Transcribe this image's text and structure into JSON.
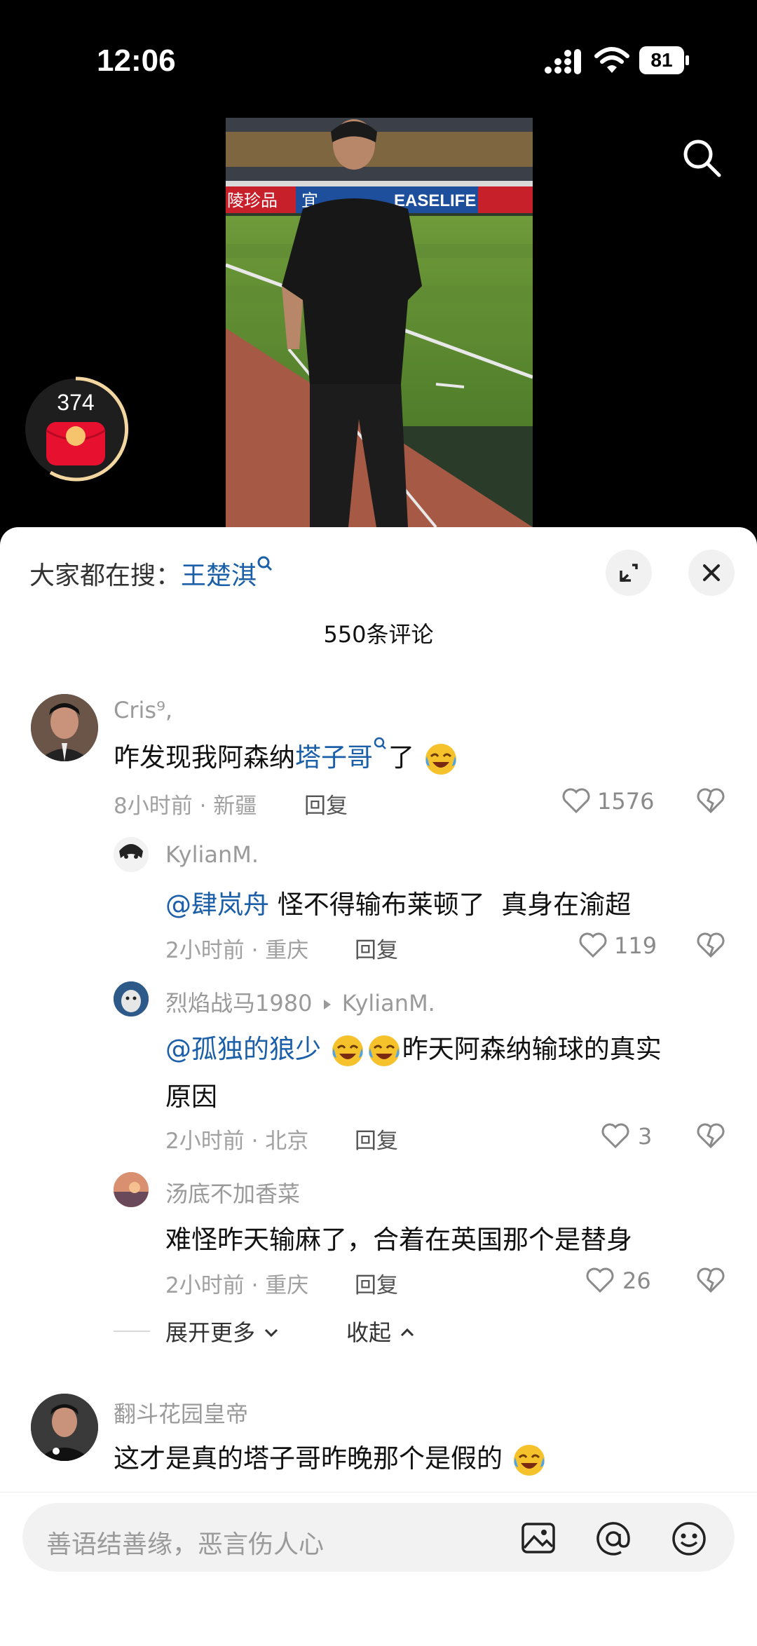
{
  "status_bar": {
    "time": "12:06",
    "battery": "81"
  },
  "red_packet": {
    "count": "374"
  },
  "hot_search": {
    "prefix": "大家都在搜：",
    "keyword": "王楚淇"
  },
  "comment_count": "550条评论",
  "comments": [
    {
      "user": "Cris⁹,",
      "text_a": "咋发现我阿森纳",
      "text_link": "塔子哥",
      "text_b": "了",
      "time": "8小时前 · 新疆",
      "reply": "回复",
      "likes": "1576"
    },
    {
      "user": "KylianM.",
      "mention": "@肆岚舟",
      "text": " 怪不得输布莱顿了  真身在渝超",
      "time": "2小时前 · 重庆",
      "reply": "回复",
      "likes": "119"
    },
    {
      "user": "烈焰战马1980",
      "reply_to": "KylianM.",
      "mention": "@孤独的狼少",
      "text_line1": "昨天阿森纳输球的真实",
      "text_line2": "原因",
      "time": "2小时前 · 北京",
      "reply": "回复",
      "likes": "3"
    },
    {
      "user": "汤底不加香菜",
      "text": "难怪昨天输麻了，合着在英国那个是替身",
      "time": "2小时前 · 重庆",
      "reply": "回复",
      "likes": "26"
    },
    {
      "user": "翻斗花园皇帝",
      "text": "这才是真的塔子哥昨晚那个是假的"
    }
  ],
  "thread_actions": {
    "expand": "展开更多",
    "collapse": "收起"
  },
  "input": {
    "placeholder": "善语结善缘，恶言伤人心"
  },
  "video": {
    "banner_text_1": "陵珍品",
    "banner_text_2": "宜",
    "banner_text_3": "EASELIFE"
  }
}
